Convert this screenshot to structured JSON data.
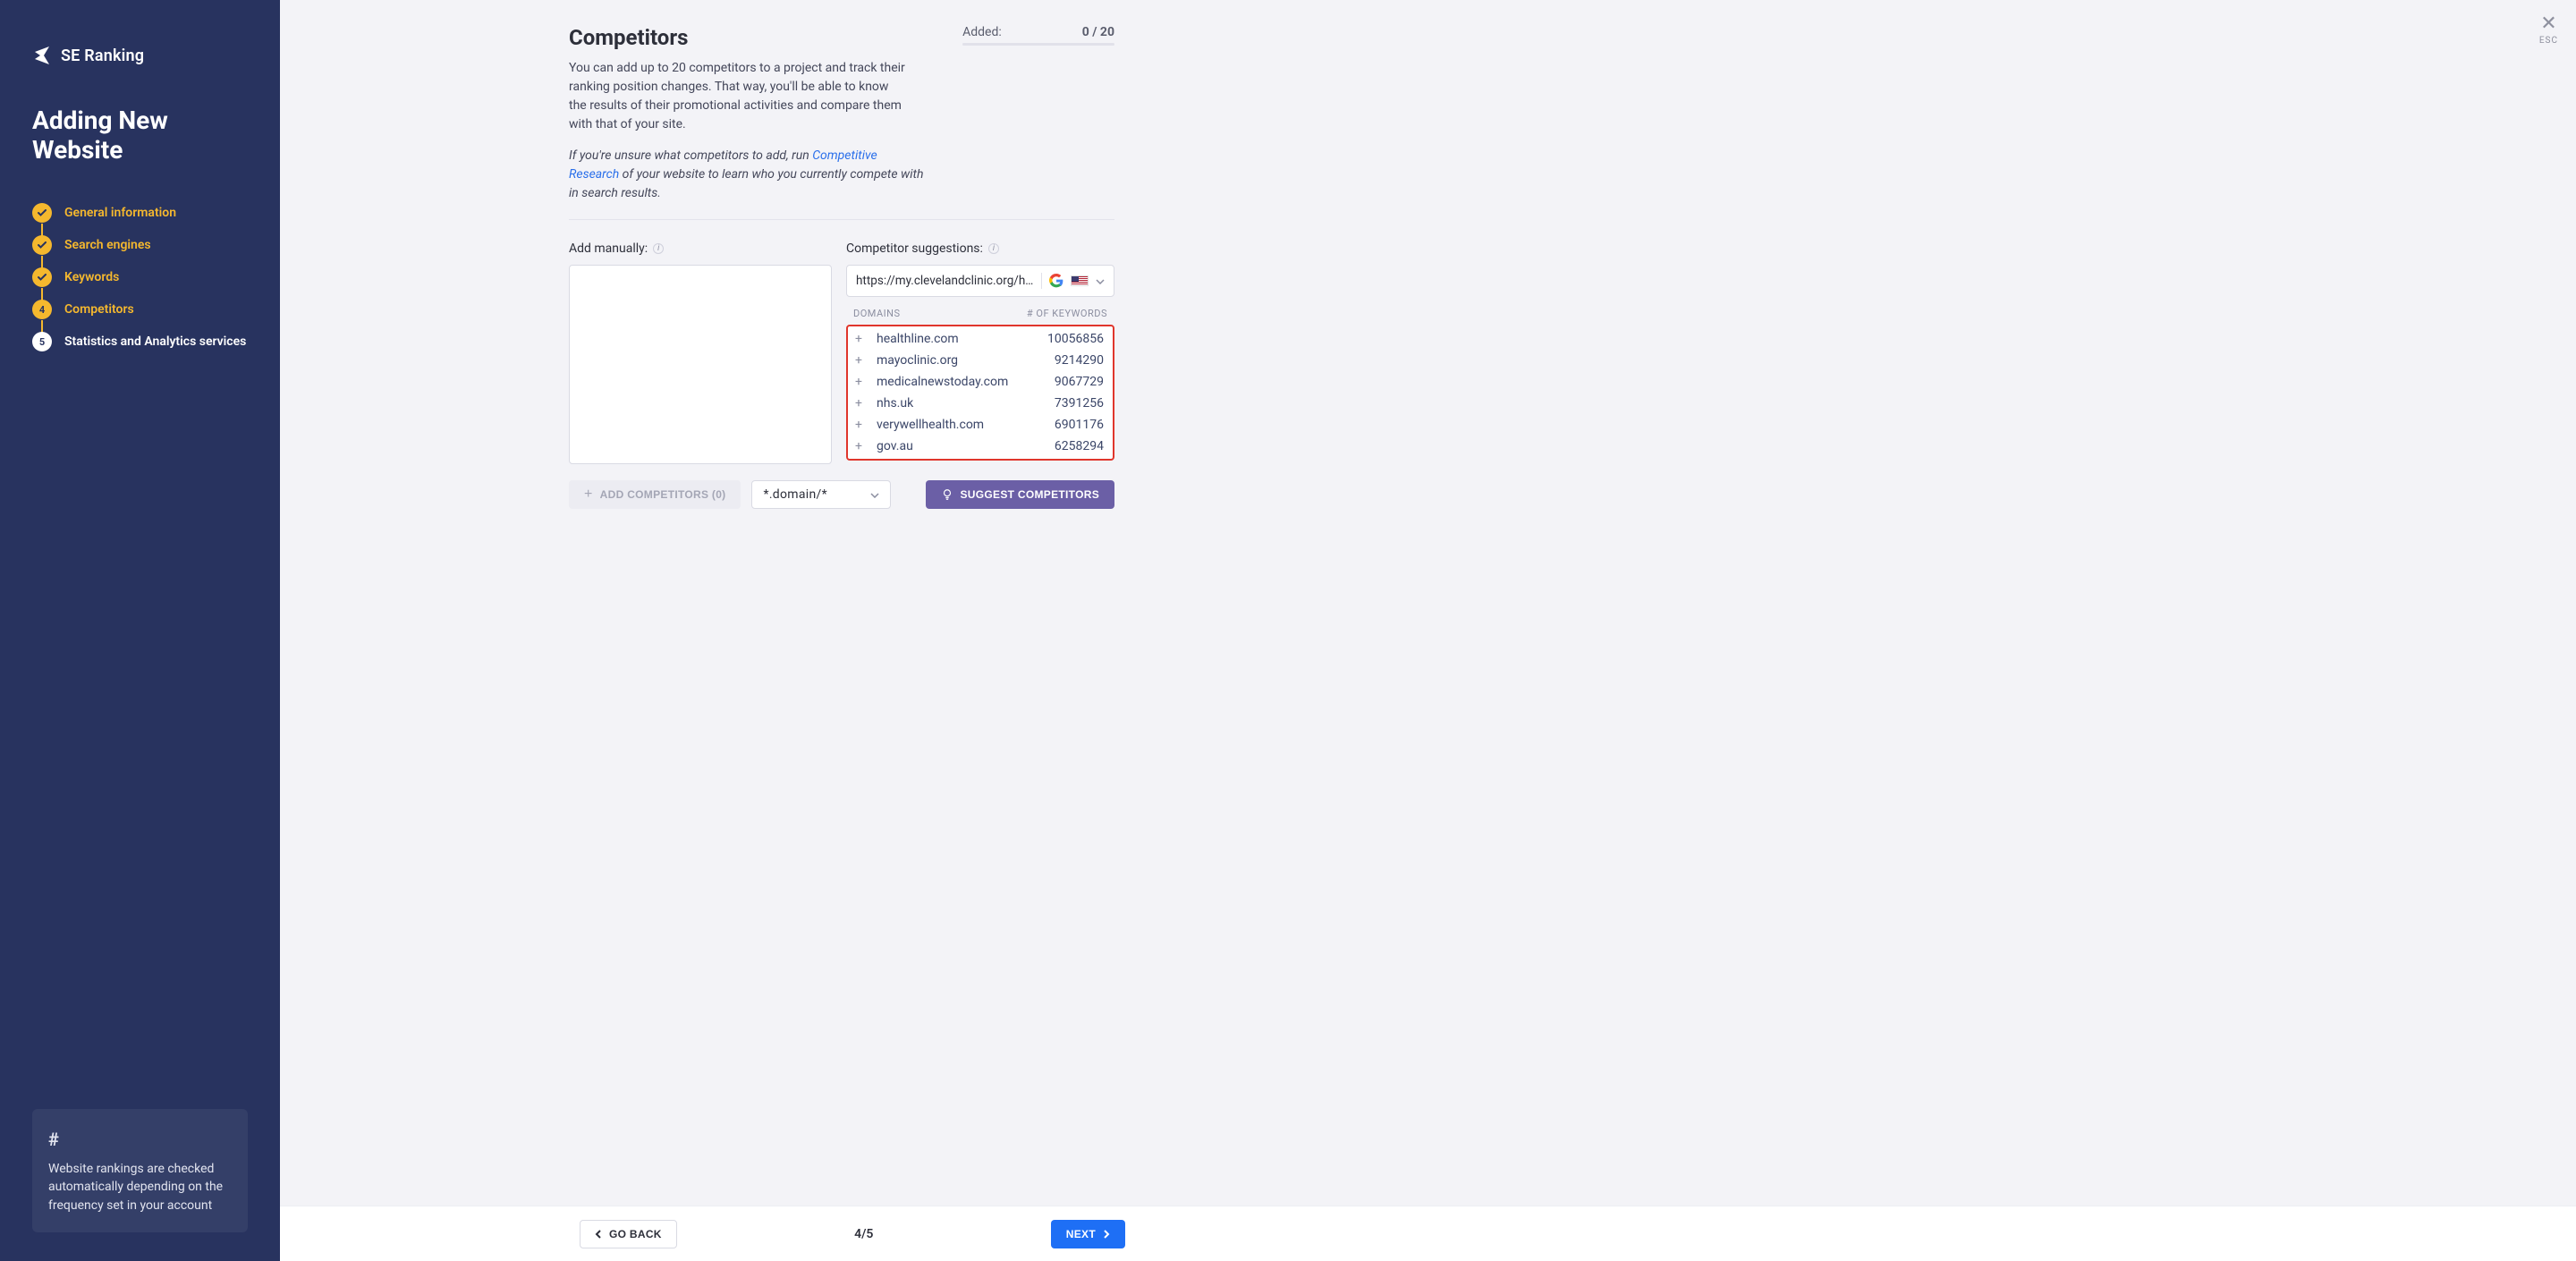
{
  "brand": {
    "name": "SE Ranking"
  },
  "sidebar": {
    "title": "Adding New Website",
    "steps": [
      {
        "label": "General information",
        "state": "done"
      },
      {
        "label": "Search engines",
        "state": "done"
      },
      {
        "label": "Keywords",
        "state": "done"
      },
      {
        "label": "Competitors",
        "state": "current",
        "num": "4"
      },
      {
        "label": "Statistics and Analytics services",
        "state": "future",
        "num": "5"
      }
    ],
    "info": {
      "hash": "#",
      "text": "Website rankings are checked automatically depending on the frequency set in your account"
    }
  },
  "main": {
    "title": "Competitors",
    "added_label": "Added:",
    "added_value": "0 / 20",
    "description": "You can add up to 20 competitors to a project and track their ranking position changes. That way, you'll be able to know the results of their promotional activities and compare them with that of your site.",
    "italic_pre": "If you're unsure what competitors to add, run ",
    "italic_link": "Competitive Research",
    "italic_post": " of your website to learn who you currently compete with in search results.",
    "add_manually_label": "Add manually:",
    "sugg_label": "Competitor suggestions:",
    "sugg_url": "https://my.clevelandclinic.org/health",
    "sugg_head_left": "DOMAINS",
    "sugg_head_right": "# OF KEYWORDS",
    "suggestions": [
      {
        "domain": "healthline.com",
        "keywords": "10056856"
      },
      {
        "domain": "mayoclinic.org",
        "keywords": "9214290"
      },
      {
        "domain": "medicalnewstoday.com",
        "keywords": "9067729"
      },
      {
        "domain": "nhs.uk",
        "keywords": "7391256"
      },
      {
        "domain": "verywellhealth.com",
        "keywords": "6901176"
      },
      {
        "domain": "gov.au",
        "keywords": "6258294"
      }
    ],
    "add_competitors_label": "ADD COMPETITORS (0)",
    "domain_select": "*.domain/*",
    "suggest_button": "SUGGEST COMPETITORS"
  },
  "footer": {
    "go_back": "GO BACK",
    "pager": "4/5",
    "next": "NEXT"
  },
  "close": {
    "esc": "ESC"
  }
}
